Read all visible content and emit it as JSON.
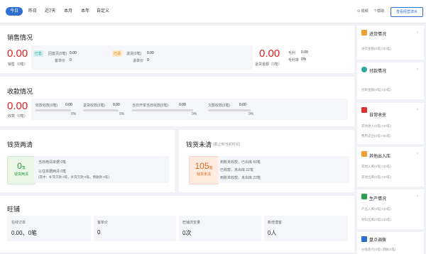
{
  "tabs": [
    "今日",
    "昨日",
    "近7天",
    "本月",
    "本年",
    "自定义"
  ],
  "top_links": {
    "video": "视频",
    "help": "帮助"
  },
  "report_button": "查看经营流水",
  "sales": {
    "title": "销售情况",
    "amount": "0.00",
    "amount_label": "销售（0笔）",
    "tag_sold": "已售",
    "sold_rows": [
      {
        "label": "回首页(0笔)",
        "value": "0.00"
      },
      {
        "label": "客单价",
        "value": "0"
      }
    ],
    "tag_return": "已退",
    "return_rows": [
      {
        "label": "退货(0笔)",
        "value": "0.00"
      },
      {
        "label": "退单价",
        "value": "0"
      }
    ],
    "return_amount": "0.00",
    "return_amount_label": "退货金额（0笔）",
    "profit_rows": [
      {
        "label": "毛利",
        "value": "0.00"
      },
      {
        "label": "毛利率",
        "value": "0%"
      }
    ]
  },
  "collection": {
    "title": "收款情况",
    "amount": "0.00",
    "amount_label": "收款（0笔）",
    "items": [
      {
        "label": "收款收款(0笔)",
        "value": "0.00",
        "pct": "0%"
      },
      {
        "label": "退货收款(0笔)",
        "value": "0.00",
        "pct": "0%"
      },
      {
        "label": "当日开单当日收款(0笔)",
        "value": "0.00",
        "pct": "0%"
      },
      {
        "label": "欠款收款(0笔)",
        "value": "0.00",
        "pct": "0%"
      }
    ]
  },
  "settled": {
    "title": "钱货两清",
    "count": "0",
    "unit": "笔",
    "badge": "钱货两清",
    "rows": [
      "当日两清单据 0笔",
      "以往单据两清 0笔",
      "(其中：补充欠款 0笔，补充欠款 0笔，预收款 0笔)"
    ]
  },
  "unsettled": {
    "title": "钱货未清",
    "subtitle": "(截止到当前时间)",
    "count": "105",
    "unit": "笔",
    "badge": "钱货未清",
    "rows": [
      "到账未收款，已出库 60笔",
      "已收款，未出库 22笔",
      "到账未收款，未出库 23笔"
    ]
  },
  "shop": {
    "title": "旺铺",
    "cells": [
      {
        "label": "在线订单",
        "value": "0.00、0笔"
      },
      {
        "label": "客单价",
        "value": "0"
      },
      {
        "label": "旺铺浏览量",
        "value": "0次"
      },
      {
        "label": "新增潜客",
        "value": "0人"
      }
    ]
  },
  "right_cards": [
    {
      "title": "进货情况",
      "sub": "进货金额(0笔)    0(0笔)",
      "icon_color": "#f0a030"
    },
    {
      "title": "付款情况",
      "sub": "付款金额(0笔)    0(0笔)",
      "icon_color": "#2aa8a0"
    },
    {
      "title": "日常收支",
      "sub1": "其他收入(0笔)    0(0笔)",
      "sub2": "费用支出(0笔)    0(0笔)",
      "icon_color": "#e03030"
    },
    {
      "title": "其他出入库",
      "sub1": "其他入库(0笔)    0(0笔)",
      "sub2": "其他出库(0笔)    0(0笔)",
      "icon_color": "#f0a030"
    },
    {
      "title": "生产情况",
      "sub1": "产品入库(0笔)    0(0笔)",
      "sub2": "材料出库(0笔)    0(0笔)",
      "icon_color": "#2aa050"
    },
    {
      "title": "盘点调拨",
      "sub": "分盘盘点(0笔)       调拨(0笔)",
      "icon_color": "#2a6fd0"
    }
  ]
}
